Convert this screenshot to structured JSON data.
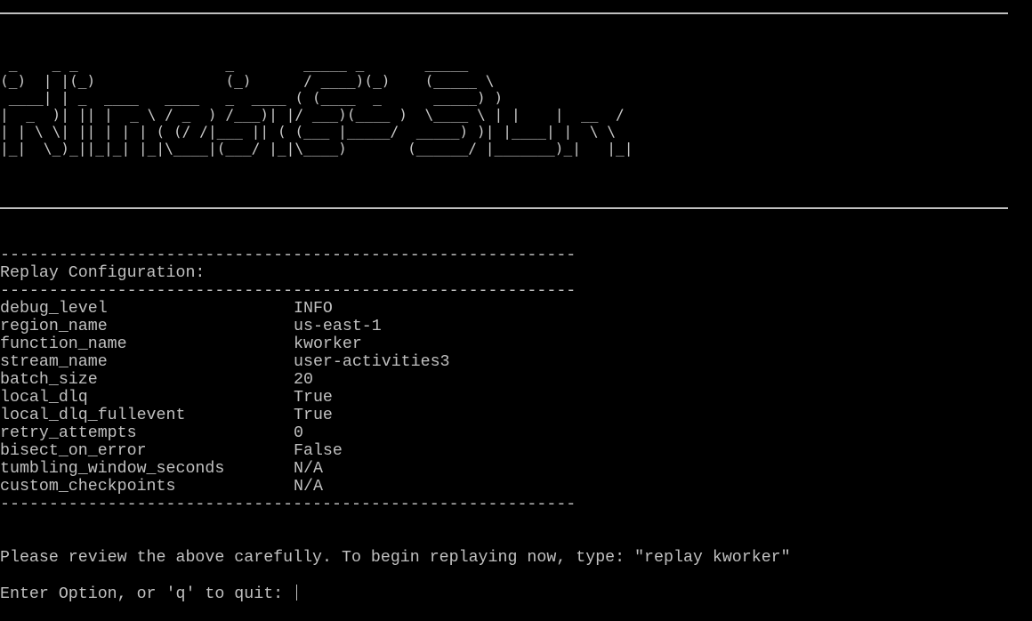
{
  "banner": {
    "ascii_art": " _    _ _                 _        _____ _       _____\n(_)  | |(_)               (_)      / ____)(_)    (_____ \\\n ____| | _  ____   ____   _  ____ ( (____  _      _____) )\n|  _  )| || |  _ \\ / _  ) /___)| |/ ___)(____ )  \\____ \\ | |    |  __  /\n| | \\ \\| || | | | ( (/ /|___ || ( (___ |_____/  _____) )| |____| |  \\ \\\n|_|  \\_)_||_|_| |_|\\____|(___/ |_|\\____)       (______/ |_______)_|   |_|",
    "text": "kinesis-SLR"
  },
  "separator": "-----------------------------------------------------------",
  "section_title": "Replay Configuration:",
  "config": [
    {
      "key": "debug_level",
      "value": "INFO"
    },
    {
      "key": "region_name",
      "value": "us-east-1"
    },
    {
      "key": "function_name",
      "value": "kworker"
    },
    {
      "key": "stream_name",
      "value": "user-activities3"
    },
    {
      "key": "batch_size",
      "value": "20"
    },
    {
      "key": "local_dlq",
      "value": "True"
    },
    {
      "key": "local_dlq_fullevent",
      "value": "True"
    },
    {
      "key": "retry_attempts",
      "value": "0"
    },
    {
      "key": "bisect_on_error",
      "value": "False"
    },
    {
      "key": "tumbling_window_seconds",
      "value": "N/A"
    },
    {
      "key": "custom_checkpoints",
      "value": "N/A"
    }
  ],
  "review_message": "Please review the above carefully. To begin replaying now, type: \"replay kworker\"",
  "prompt": "Enter Option, or 'q' to quit: ",
  "colors": {
    "background": "#000000",
    "foreground": "#c0c0c0"
  }
}
